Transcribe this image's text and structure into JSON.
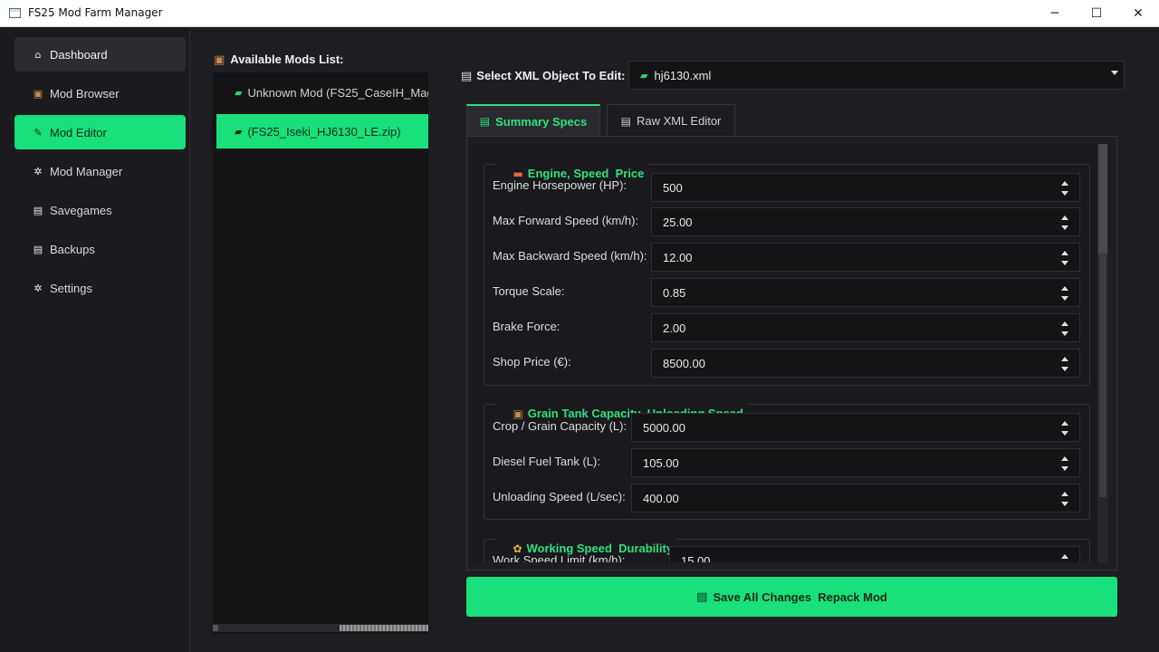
{
  "window": {
    "title": "FS25 Mod Farm Manager",
    "controls": {
      "minimize": "─",
      "maximize": "☐",
      "close": "✕"
    }
  },
  "sidebar": {
    "items": [
      {
        "label": "Dashboard",
        "icon": "home-icon",
        "glyph": "⌂"
      },
      {
        "label": "Mod Browser",
        "icon": "package-icon",
        "glyph": "▣"
      },
      {
        "label": "Mod Editor",
        "icon": "pencil-icon",
        "glyph": "✎"
      },
      {
        "label": "Mod Manager",
        "icon": "gear-icon",
        "glyph": "✲"
      },
      {
        "label": "Savegames",
        "icon": "floppy-icon",
        "glyph": "▤"
      },
      {
        "label": "Backups",
        "icon": "floppy-icon",
        "glyph": "▤"
      },
      {
        "label": "Settings",
        "icon": "gear-icon",
        "glyph": "✲"
      }
    ],
    "active_index": 2
  },
  "mods": {
    "header": "Available Mods List:",
    "header_glyph": "▣",
    "items": [
      {
        "label": "Unknown Mod (FS25_CaseIH_Mag",
        "glyph": "▰"
      },
      {
        "label": "(FS25_Iseki_HJ6130_LE.zip)",
        "glyph": "▰"
      }
    ],
    "selected_index": 1
  },
  "editor": {
    "select_label": "Select XML Object To Edit:",
    "select_label_glyph": "▤",
    "selected_file": "hj6130.xml",
    "selected_file_glyph": "▰",
    "tabs": [
      {
        "label": "Summary Specs",
        "glyph": "▤"
      },
      {
        "label": "Raw XML Editor",
        "glyph": "▤"
      }
    ],
    "active_tab": 0,
    "groups": [
      {
        "title": "Engine, Speed  Price",
        "glyph": "▬",
        "fields": [
          {
            "label": "Engine Horsepower (HP):",
            "value": "500"
          },
          {
            "label": "Max Forward Speed (km/h):",
            "value": "25.00"
          },
          {
            "label": "Max Backward Speed (km/h):",
            "value": "12.00"
          },
          {
            "label": "Torque Scale:",
            "value": "0.85"
          },
          {
            "label": "Brake Force:",
            "value": "2.00"
          },
          {
            "label": "Shop Price (€):",
            "value": "8500.00"
          }
        ]
      },
      {
        "title": "Grain Tank Capacity  Unloading Speed",
        "glyph": "▣",
        "fields": [
          {
            "label": "Crop / Grain Capacity (L):",
            "value": "5000.00"
          },
          {
            "label": "Diesel Fuel Tank (L):",
            "value": "105.00"
          },
          {
            "label": "Unloading Speed (L/sec):",
            "value": "400.00"
          }
        ]
      },
      {
        "title": "Working Speed  Durability",
        "glyph": "✿",
        "fields": [
          {
            "label": "Work Speed Limit (km/h):",
            "value": "15.00"
          }
        ]
      }
    ],
    "save_button": "Save All Changes  Repack Mod",
    "save_glyph": "▤"
  },
  "colors": {
    "accent": "#19e07a",
    "accent_text": "#2fe07e",
    "background": "#1e1e22",
    "panel": "#141417"
  }
}
